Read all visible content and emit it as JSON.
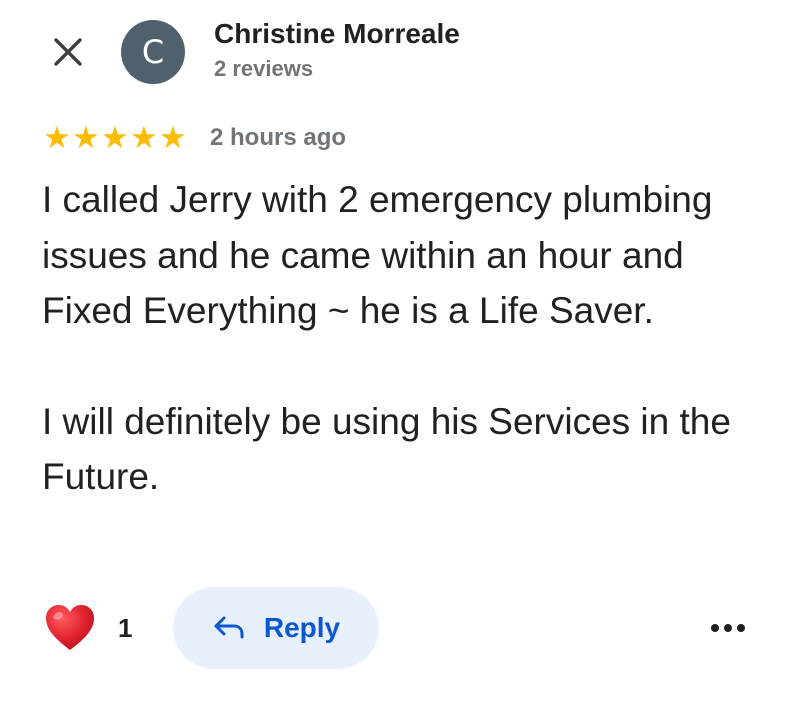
{
  "header": {
    "close_icon": "close-icon",
    "avatar_letter": "C",
    "avatar_color": "#4f616c",
    "reviewer_name": "Christine Morreale",
    "reviewer_reviews": "2 reviews"
  },
  "rating": {
    "stars": 5,
    "max_stars": 5,
    "star_color": "#fbbc04",
    "time_ago": "2 hours ago"
  },
  "review": {
    "paragraph1": "I called Jerry with 2 emergency plumbing issues and he came within an hour and Fixed Everything ~ he is a Life Saver.",
    "paragraph2": "I will definitely be using his Services in the Future."
  },
  "actions": {
    "like_icon": "heart-icon",
    "like_count": "1",
    "reply_icon": "reply-arrow-icon",
    "reply_label": "Reply",
    "reply_color": "#0b57d0",
    "reply_bg": "#e8f0fe",
    "more_icon": "more-horizontal-icon"
  }
}
